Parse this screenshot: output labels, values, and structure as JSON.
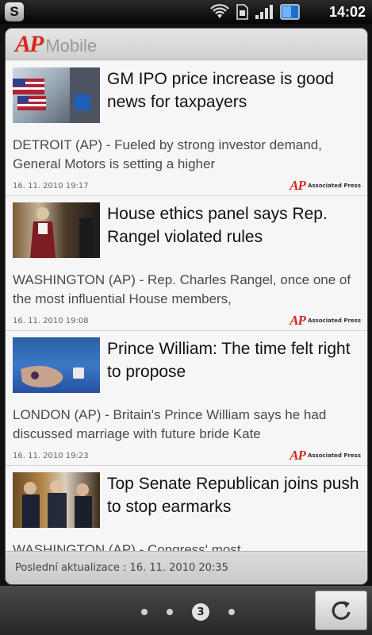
{
  "statusbar": {
    "app_badge": "S",
    "clock": "14:02"
  },
  "widget": {
    "logo_mark": "AP",
    "logo_text": "Mobile",
    "credit_mark": "AP",
    "credit_text": "Associated Press",
    "footer": "Poslední aktualizace : 16. 11. 2010 20:35",
    "items": [
      {
        "headline": "GM IPO price increase is good news for taxpayers",
        "summary": "DETROIT (AP) - Fueled by strong investor demand, General Motors is setting a higher",
        "date": "16. 11. 2010 19:17"
      },
      {
        "headline": "House ethics panel says Rep. Rangel violated rules",
        "summary": "WASHINGTON (AP) - Rep. Charles Rangel, once one of the most influential House members,",
        "date": "16. 11. 2010 19:08"
      },
      {
        "headline": "Prince William: The time felt right to propose",
        "summary": "LONDON (AP) - Britain's Prince William says he had discussed marriage with future bride Kate",
        "date": "16. 11. 2010 19:23"
      },
      {
        "headline": "Top Senate Republican joins push to stop earmarks",
        "summary": "WASHINGTON (AP) - Congress' most",
        "date": ""
      }
    ]
  },
  "pager": {
    "current": "3"
  },
  "icons": {
    "wifi": "wifi-icon",
    "sim": "sim-icon",
    "signal": "signal-icon",
    "battery": "battery-icon",
    "refresh": "refresh-icon"
  },
  "colors": {
    "ap_red": "#d9261c"
  }
}
